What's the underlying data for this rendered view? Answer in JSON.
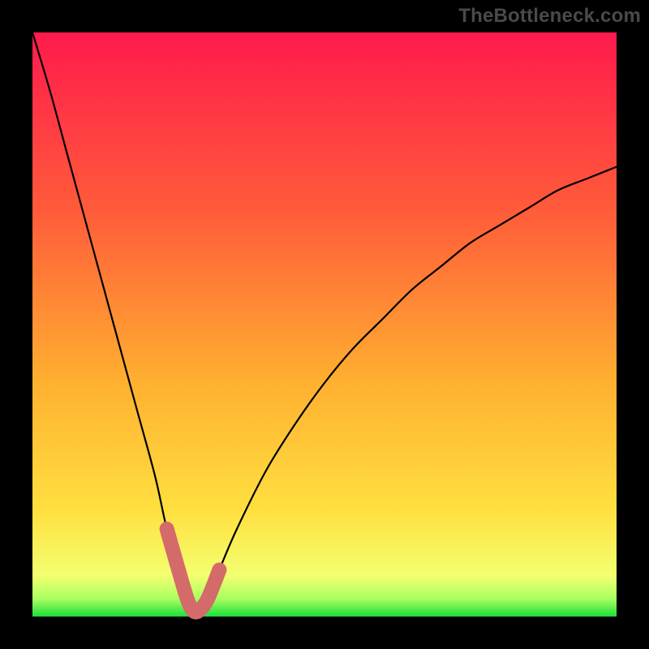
{
  "watermark": "TheBottleneck.com",
  "colors": {
    "page_bg": "#000000",
    "gradient_stops": [
      "#ff1a4d",
      "#ff5a3a",
      "#ffb030",
      "#ffe040",
      "#f3ff70",
      "#a8ff60",
      "#1bdf3a"
    ],
    "curve": "#000000",
    "highlight": "#d46a6a"
  },
  "chart_data": {
    "type": "line",
    "title": "",
    "xlabel": "",
    "ylabel": "",
    "xlim": [
      0,
      100
    ],
    "ylim": [
      0,
      100
    ],
    "series": [
      {
        "name": "bottleneck-curve",
        "x": [
          0,
          3,
          6,
          9,
          12,
          15,
          18,
          21,
          23,
          25,
          26.5,
          27.5,
          28.5,
          30,
          32,
          35,
          40,
          45,
          50,
          55,
          60,
          65,
          70,
          75,
          80,
          85,
          90,
          95,
          100
        ],
        "y": [
          100,
          90,
          79,
          68,
          57,
          46,
          35,
          24,
          15,
          8,
          3,
          1,
          1,
          3,
          8,
          15,
          25,
          33,
          40,
          46,
          51,
          56,
          60,
          64,
          67,
          70,
          73,
          75,
          77
        ]
      }
    ],
    "highlight_segment": {
      "curve": "bottleneck-curve",
      "x_range": [
        23,
        32
      ],
      "note": "thick rounded pink overlay near the valley"
    }
  }
}
